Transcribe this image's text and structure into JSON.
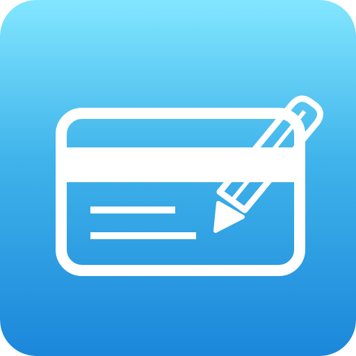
{
  "icon": {
    "name": "expense-card-edit-app-icon",
    "glyphs": [
      "card-icon",
      "pencil-icon"
    ],
    "colors": {
      "background_top": "#82E6FF",
      "background_mid": "#3FB3EA",
      "background_bottom": "#1C87DA",
      "foreground": "#FFFFFF"
    }
  }
}
